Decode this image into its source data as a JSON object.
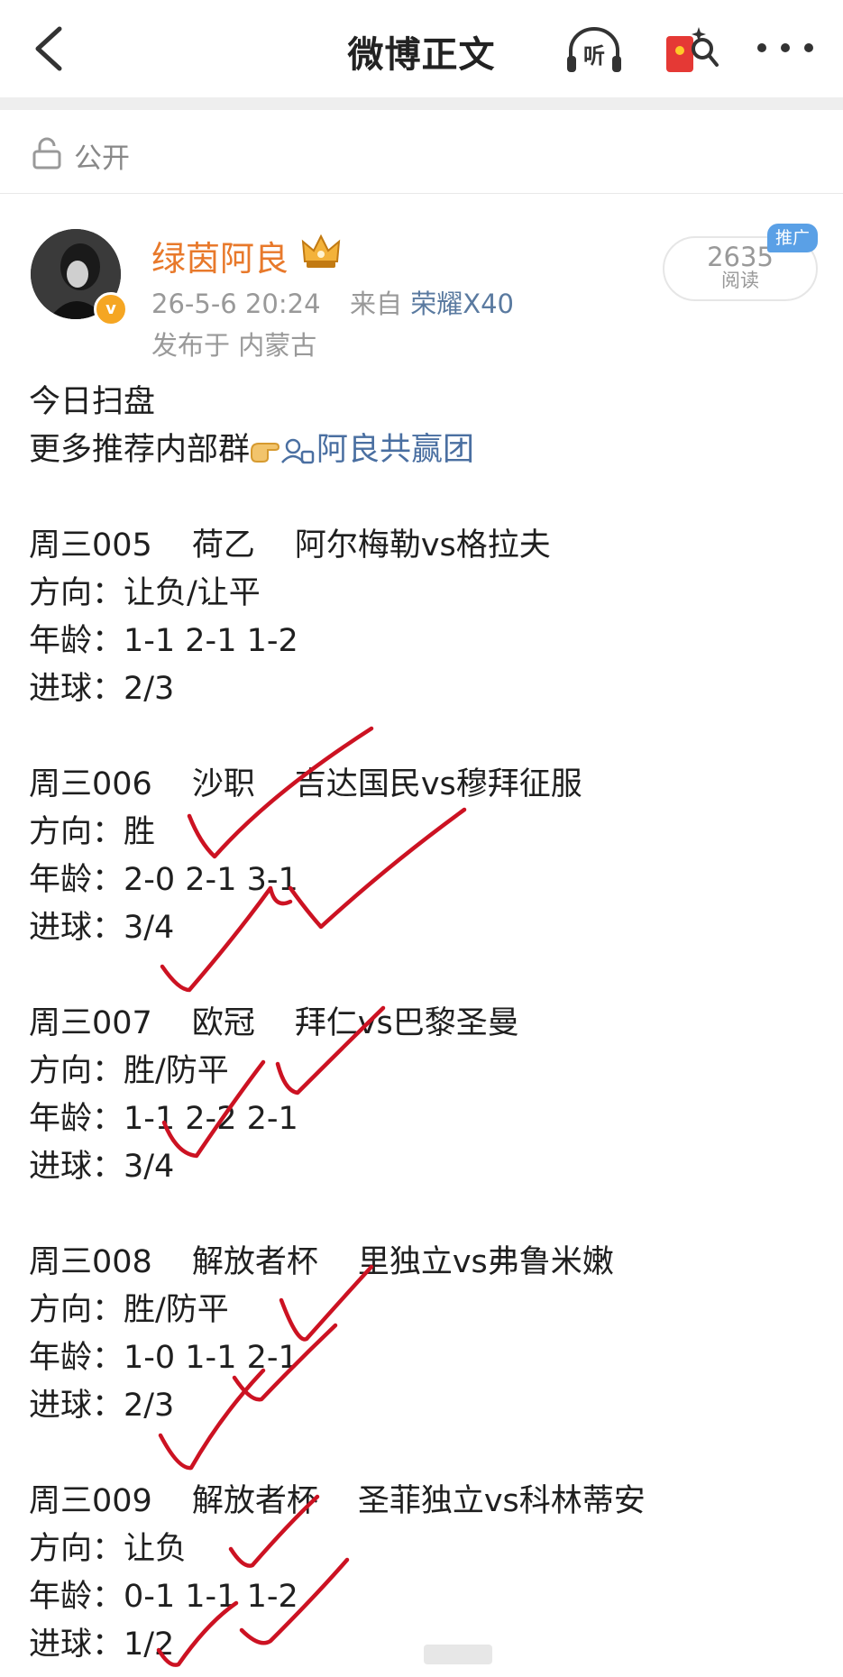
{
  "header": {
    "title": "微博正文",
    "listen_label": "听",
    "icons": {
      "back": "back-arrow-icon",
      "listen": "headphone-icon",
      "redpacket": "red-packet-icon",
      "more": "more-icon"
    }
  },
  "visibility": {
    "label": "公开",
    "icon": "lock-icon"
  },
  "post": {
    "author": "绿茵阿良",
    "timestamp": "26-5-6 20:24",
    "source_prefix": "来自",
    "device": "荣耀X40",
    "location": "发布于 内蒙古",
    "read_count": "2635",
    "read_label": "阅读",
    "promo_tag": "推广"
  },
  "body": {
    "line1": "今日扫盘",
    "line2_text": "更多推荐内部群",
    "group_name": "阿良共赢团",
    "matches": [
      {
        "id": "周三005",
        "league": "荷乙",
        "teams": "阿尔梅勒vs格拉夫",
        "direction": "方向：让负/让平",
        "age": "年龄：1-1 2-1 1-2",
        "goals": "进球：2/3"
      },
      {
        "id": "周三006",
        "league": "沙职",
        "teams": "吉达国民vs穆拜征服",
        "direction": "方向：胜",
        "age": "年龄：2-0 2-1 3-1",
        "goals": "进球：3/4"
      },
      {
        "id": "周三007",
        "league": "欧冠",
        "teams": "拜仁vs巴黎圣曼",
        "direction": "方向：胜/防平",
        "age": "年龄：1-1 2-2 2-1",
        "goals": "进球：3/4"
      },
      {
        "id": "周三008",
        "league": "解放者杯",
        "teams": "里独立vs弗鲁米嫩",
        "direction": "方向：胜/防平",
        "age": "年龄：1-0 1-1 2-1",
        "goals": "进球：2/3"
      },
      {
        "id": "周三009",
        "league": "解放者杯",
        "teams": "圣菲独立vs科林蒂安",
        "direction": "方向：让负",
        "age": "年龄：0-1 1-1 1-2",
        "goals": "进球：1/2"
      }
    ]
  },
  "colors": {
    "accent_name": "#e8792b",
    "link": "#4a6fa1",
    "check_ink": "#cc1222",
    "promo": "#5aa0e6"
  }
}
